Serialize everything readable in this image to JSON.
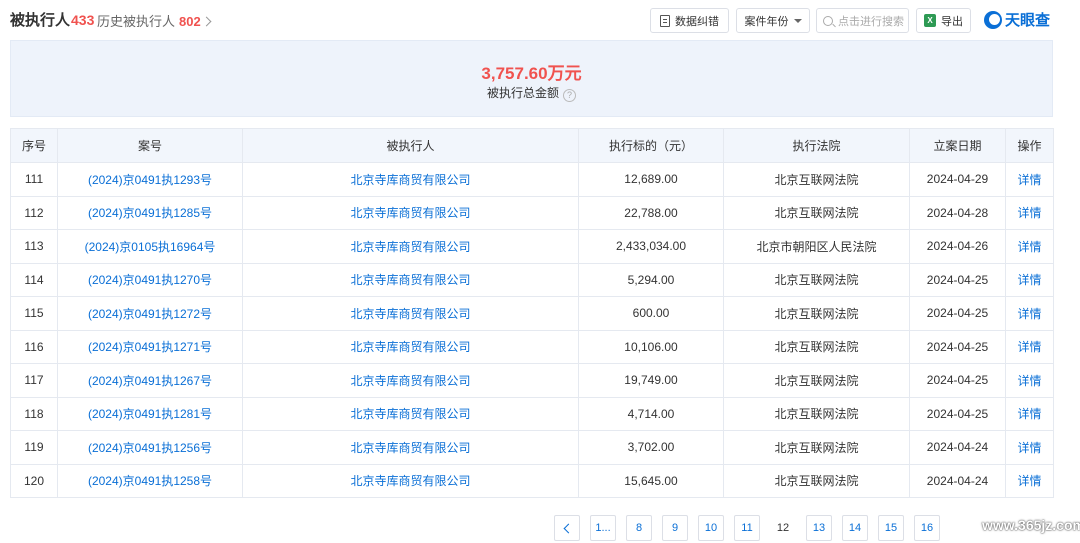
{
  "header": {
    "tab_current_label": "被执行人",
    "tab_current_count": "433",
    "tab_history_label": "历史被执行人",
    "tab_history_count": "802",
    "report_error_label": "数据纠错",
    "case_year_label": "案件年份",
    "search_placeholder": "点击进行搜索",
    "export_label": "导出",
    "logo_text": "天眼查",
    "icons": [
      "document-icon",
      "caret-down-icon",
      "search-icon",
      "excel-icon",
      "tianyancha-logo-icon"
    ]
  },
  "summary": {
    "total_amount": "3,757.60万元",
    "label": "被执行总金额",
    "help_glyph": "?"
  },
  "table": {
    "columns": [
      "序号",
      "案号",
      "被执行人",
      "执行标的（元）",
      "执行法院",
      "立案日期",
      "操作"
    ],
    "rows": [
      {
        "no": "111",
        "case": "(2024)京0491执1293号",
        "party": "北京寺库商贸有限公司",
        "amount": "12,689.00",
        "court": "北京互联网法院",
        "date": "2024-04-29",
        "action": "详情"
      },
      {
        "no": "112",
        "case": "(2024)京0491执1285号",
        "party": "北京寺库商贸有限公司",
        "amount": "22,788.00",
        "court": "北京互联网法院",
        "date": "2024-04-28",
        "action": "详情"
      },
      {
        "no": "113",
        "case": "(2024)京0105执16964号",
        "party": "北京寺库商贸有限公司",
        "amount": "2,433,034.00",
        "court": "北京市朝阳区人民法院",
        "date": "2024-04-26",
        "action": "详情"
      },
      {
        "no": "114",
        "case": "(2024)京0491执1270号",
        "party": "北京寺库商贸有限公司",
        "amount": "5,294.00",
        "court": "北京互联网法院",
        "date": "2024-04-25",
        "action": "详情"
      },
      {
        "no": "115",
        "case": "(2024)京0491执1272号",
        "party": "北京寺库商贸有限公司",
        "amount": "600.00",
        "court": "北京互联网法院",
        "date": "2024-04-25",
        "action": "详情"
      },
      {
        "no": "116",
        "case": "(2024)京0491执1271号",
        "party": "北京寺库商贸有限公司",
        "amount": "10,106.00",
        "court": "北京互联网法院",
        "date": "2024-04-25",
        "action": "详情"
      },
      {
        "no": "117",
        "case": "(2024)京0491执1267号",
        "party": "北京寺库商贸有限公司",
        "amount": "19,749.00",
        "court": "北京互联网法院",
        "date": "2024-04-25",
        "action": "详情"
      },
      {
        "no": "118",
        "case": "(2024)京0491执1281号",
        "party": "北京寺库商贸有限公司",
        "amount": "4,714.00",
        "court": "北京互联网法院",
        "date": "2024-04-25",
        "action": "详情"
      },
      {
        "no": "119",
        "case": "(2024)京0491执1256号",
        "party": "北京寺库商贸有限公司",
        "amount": "3,702.00",
        "court": "北京互联网法院",
        "date": "2024-04-24",
        "action": "详情"
      },
      {
        "no": "120",
        "case": "(2024)京0491执1258号",
        "party": "北京寺库商贸有限公司",
        "amount": "15,645.00",
        "court": "北京互联网法院",
        "date": "2024-04-24",
        "action": "详情"
      }
    ]
  },
  "pagination": {
    "pages": [
      "1...",
      "8",
      "9",
      "10",
      "11",
      "12",
      "13",
      "14",
      "15",
      "16"
    ],
    "current": "12"
  },
  "watermark": "www.365jz.com",
  "colors": {
    "accent_red": "#f0524f",
    "link_blue": "#0a6fd6",
    "header_bg": "#f2f6fc",
    "summary_bg": "#eef3fb"
  }
}
